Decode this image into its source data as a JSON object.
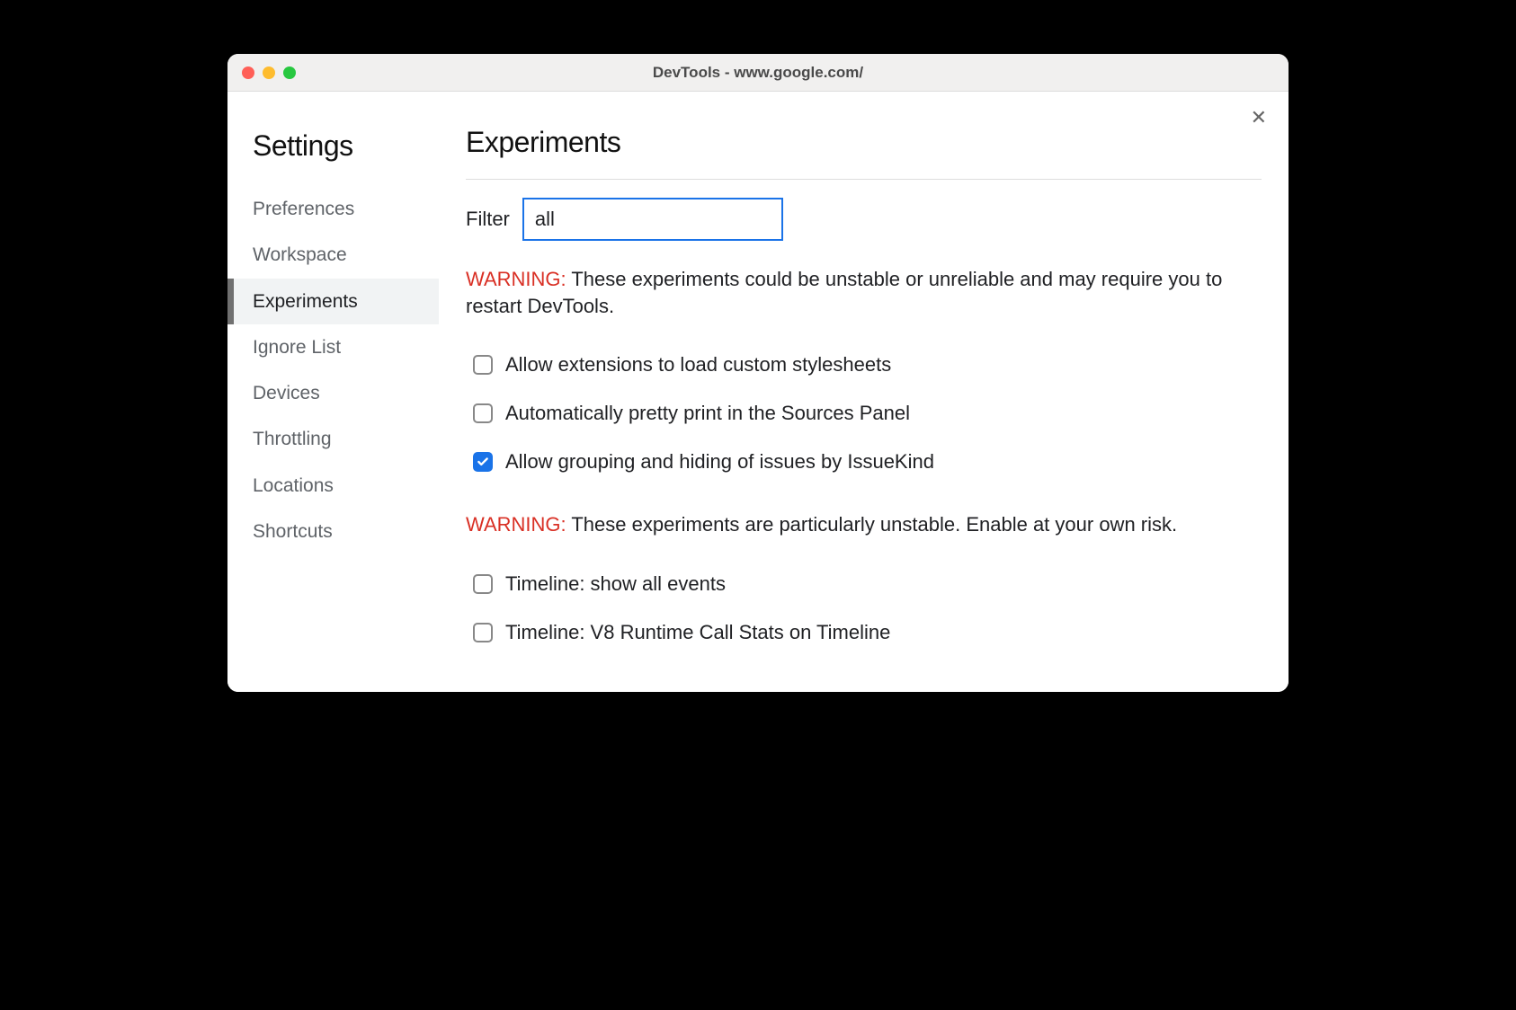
{
  "window": {
    "title": "DevTools - www.google.com/"
  },
  "sidebar": {
    "title": "Settings",
    "items": [
      {
        "label": "Preferences",
        "active": false
      },
      {
        "label": "Workspace",
        "active": false
      },
      {
        "label": "Experiments",
        "active": true
      },
      {
        "label": "Ignore List",
        "active": false
      },
      {
        "label": "Devices",
        "active": false
      },
      {
        "label": "Throttling",
        "active": false
      },
      {
        "label": "Locations",
        "active": false
      },
      {
        "label": "Shortcuts",
        "active": false
      }
    ]
  },
  "main": {
    "heading": "Experiments",
    "filter": {
      "label": "Filter",
      "value": "all"
    },
    "warning1": {
      "prefix": "WARNING:",
      "text": " These experiments could be unstable or unreliable and may require you to restart DevTools."
    },
    "experiments_primary": [
      {
        "label": "Allow extensions to load custom stylesheets",
        "checked": false
      },
      {
        "label": "Automatically pretty print in the Sources Panel",
        "checked": false
      },
      {
        "label": "Allow grouping and hiding of issues by IssueKind",
        "checked": true
      }
    ],
    "warning2": {
      "prefix": "WARNING:",
      "text": " These experiments are particularly unstable. Enable at your own risk."
    },
    "experiments_unstable": [
      {
        "label": "Timeline: show all events",
        "checked": false
      },
      {
        "label": "Timeline: V8 Runtime Call Stats on Timeline",
        "checked": false
      }
    ]
  },
  "close_label": "✕"
}
